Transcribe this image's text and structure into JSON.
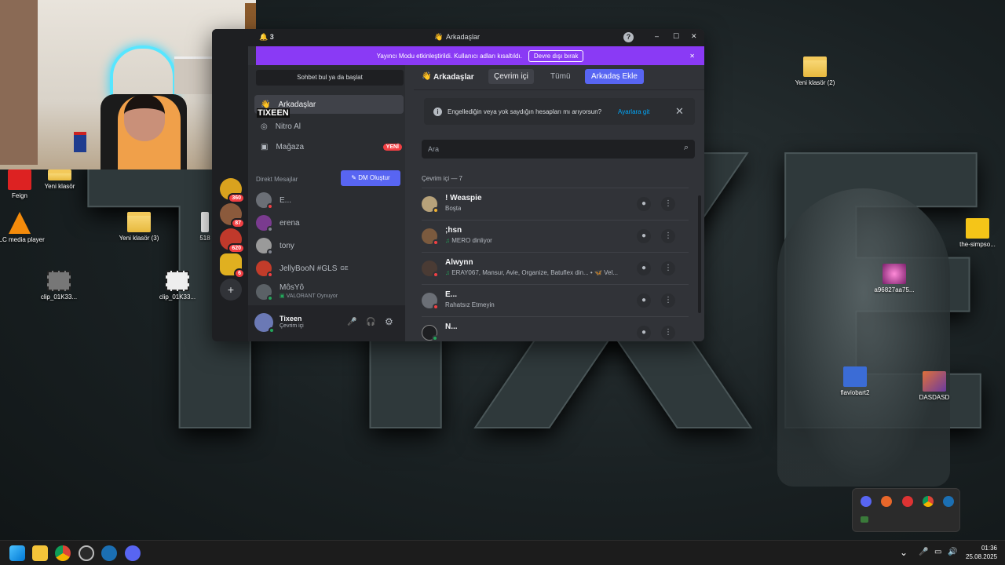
{
  "desktop": {
    "icons": [
      {
        "label": "Feign"
      },
      {
        "label": "Yeni klasör"
      },
      {
        "label": "VLC media player"
      },
      {
        "label": "Yeni klasör (3)"
      },
      {
        "label": "518"
      },
      {
        "label": "clip_01K33..."
      },
      {
        "label": "clip_01K33..."
      },
      {
        "label": "Yeni klasör (2)"
      },
      {
        "label": "the-simpso..."
      },
      {
        "label": "a96827aa75..."
      },
      {
        "label": "flaviobart2"
      },
      {
        "label": "DASDASD"
      }
    ],
    "webcam_label": "TIXEEN"
  },
  "discord": {
    "titlebar": {
      "title": "Arkadaşlar",
      "notif_count": "3",
      "help": "?",
      "minimize": "–",
      "maximize": "☐",
      "close": "✕"
    },
    "banner": {
      "text": "Yayıncı Modu etkinleştirildi. Kullanıcı adları kısaltıldı.",
      "button": "Devre dışı bırak",
      "close": "✕"
    },
    "servers": [
      {
        "badge": "360",
        "color": "#d9a21e"
      },
      {
        "badge": "87",
        "color": "#8b5a3c"
      },
      {
        "badge": "620",
        "color": "#c0392b"
      },
      {
        "badge": "6",
        "color": "#e0b020"
      }
    ],
    "sidebar": {
      "search": "Sohbet bul ya da başlat",
      "nav": [
        {
          "label": "Arkadaşlar"
        },
        {
          "label": "Nitro Al"
        },
        {
          "label": "Mağaza",
          "badge": "YENİ"
        }
      ],
      "dm_header": "Direkt Mesajlar",
      "dm_button": "DM Oluştur",
      "dms": [
        {
          "name": "E...",
          "status": "",
          "color": "#6b6f76",
          "presence": "red"
        },
        {
          "name": "erena",
          "status": "",
          "color": "#7a3b8f",
          "presence": "gray"
        },
        {
          "name": "tony",
          "status": "",
          "color": "#9a9a9a",
          "presence": "gray"
        },
        {
          "name": "JellyBooN #GLS",
          "tag": "GE",
          "status": "",
          "color": "#c23c2a",
          "presence": "red"
        },
        {
          "name": "MôsYô",
          "status": "VALORANT Oynuyor",
          "color": "#5b6166",
          "presence": "green"
        }
      ],
      "user": {
        "name": "Tixeen",
        "status": "Çevrim içi",
        "mic": "🎤",
        "headset": "🎧",
        "settings": "⚙"
      }
    },
    "header": {
      "title": "Arkadaşlar",
      "tabs": [
        "Çevrim içi",
        "Tümü"
      ],
      "add_friend": "Arkadaş Ekle"
    },
    "notice": {
      "text": "Engellediğin veya yok saydığın hesapları mı arıyorsun?",
      "link": "Ayarlara git",
      "close": "✕"
    },
    "search": {
      "placeholder": "Ara"
    },
    "online_header": "Çevrim içi — 7",
    "friends": [
      {
        "name": "! Weaspie",
        "status": "Boşta",
        "color": "#b7a27a",
        "presence": "yellow",
        "music": false
      },
      {
        "name": ";hsn",
        "status": "MERO dinliyor",
        "color": "#7b5a3e",
        "presence": "red",
        "music": true
      },
      {
        "name": "Alwynn",
        "status": "ERAY067, Mansur, Avie, Organize, Batuflex din... • 🦋 Vel...",
        "color": "#4a3b34",
        "presence": "red",
        "music": true
      },
      {
        "name": "E...",
        "status": "Rahatsız Etmeyin",
        "color": "#6b6f76",
        "presence": "red",
        "music": false
      },
      {
        "name": "N...",
        "status": "",
        "color": "#1e1f22",
        "presence": "green",
        "music": false
      }
    ]
  },
  "tray": {
    "time": "01:36",
    "date": "25.08.2025",
    "chevron": "⌄"
  }
}
